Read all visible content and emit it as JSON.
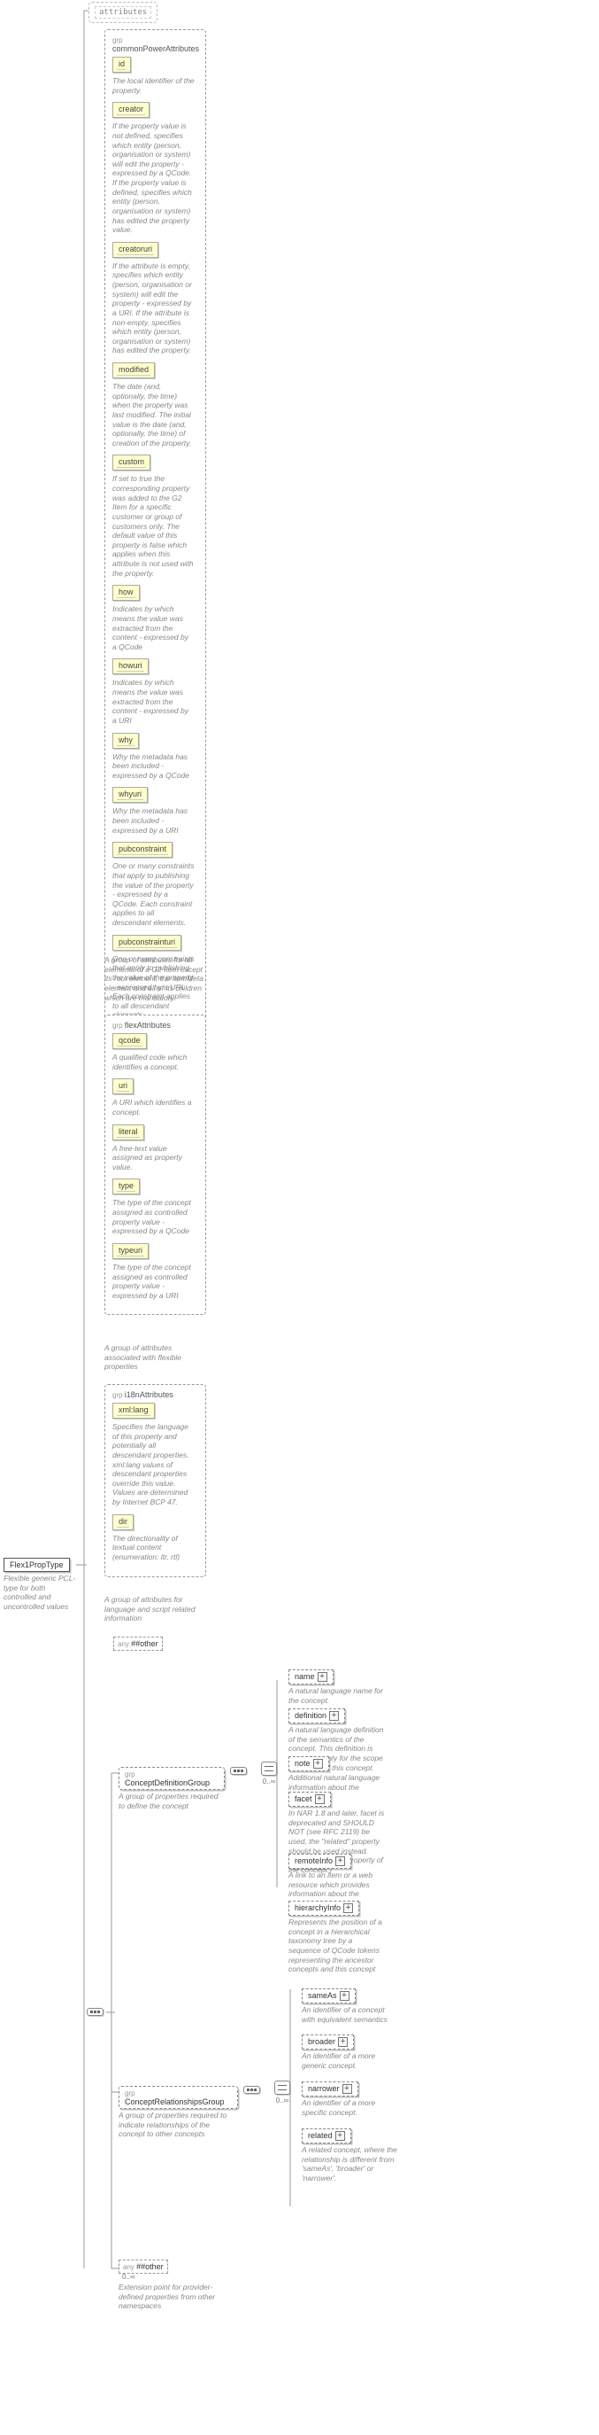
{
  "root": {
    "name": "Flex1PropType",
    "doc": "Flexible generic PCL-type for both controlled and uncontrolled values"
  },
  "groups": {
    "common": {
      "title": "commonPowerAttributes",
      "attrs": [
        {
          "name": "id",
          "doc": "The local identifier of the property."
        },
        {
          "name": "creator",
          "doc": "If the property value is not defined, specifies which entity (person, organisation or system) will edit the property - expressed by a QCode. If the property value is defined, specifies which entity (person, organisation or system) has edited the property value."
        },
        {
          "name": "creatoruri",
          "doc": "If the attribute is empty, specifies which entity (person, organisation or system) will edit the property - expressed by a URI. If the attribute is non-empty, specifies which entity (person, organisation or system) has edited the property."
        },
        {
          "name": "modified",
          "doc": "The date (and, optionally, the time) when the property was last modified. The initial value is the date (and, optionally, the time) of creation of the property."
        },
        {
          "name": "custom",
          "doc": "If set to true the corresponding property was added to the G2 Item for a specific customer or group of customers only. The default value of this property is false which applies when this attribute is not used with the property."
        },
        {
          "name": "how",
          "doc": "Indicates by which means the value was extracted from the content - expressed by a QCode"
        },
        {
          "name": "howuri",
          "doc": "Indicates by which means the value was extracted from the content - expressed by a URI"
        },
        {
          "name": "why",
          "doc": "Why the metadata has been included - expressed by a QCode"
        },
        {
          "name": "whyuri",
          "doc": "Why the metadata has been included - expressed by a URI"
        },
        {
          "name": "pubconstraint",
          "doc": "One or many constraints that apply to publishing the value of the property - expressed by a QCode. Each constraint applies to all descendant elements."
        },
        {
          "name": "pubconstrainturi",
          "doc": "One or many constraints that apply to publishing the value of the property - expressed by a URI. Each constraint applies to all descendant elements."
        }
      ],
      "footer": "A group of attributes for all elements of a G2 Item except its root element, the itemMeta element and all of its children which are mandatory."
    },
    "flex": {
      "title": "flexAttributes",
      "attrs": [
        {
          "name": "qcode",
          "doc": "A qualified code which identifies a concept."
        },
        {
          "name": "uri",
          "doc": "A URI which identifies a concept."
        },
        {
          "name": "literal",
          "doc": "A free-text value assigned as property value."
        },
        {
          "name": "type",
          "doc": "The type of the concept assigned as controlled property value - expressed by a QCode"
        },
        {
          "name": "typeuri",
          "doc": "The type of the concept assigned as controlled property value - expressed by a URI"
        }
      ],
      "footer": "A group of attributes associated with flexible properties"
    },
    "i18n": {
      "title": "i18nAttributes",
      "attrs": [
        {
          "name": "xml:lang",
          "doc": "Specifies the language of this property and potentially all descendant properties. xml:lang values of descendant properties override this value. Values are determined by Internet BCP 47."
        },
        {
          "name": "dir",
          "doc": "The directionality of textual content (enumeration: ltr, rtl)"
        }
      ],
      "footer": "A group of attributes for language and script related information"
    }
  },
  "attributesLabel": "attributes",
  "anyOther": "##other",
  "conceptDef": {
    "label": "ConceptDefinitionGroup",
    "doc": "A group of properties required to define the concept",
    "children": [
      {
        "name": "name",
        "doc": "A natural language name for the concept."
      },
      {
        "name": "definition",
        "doc": "A natural language definition of the semantics of the concept. This definition is normative only for the scope of the use of this concept."
      },
      {
        "name": "note",
        "doc": "Additional natural language information about the concept."
      },
      {
        "name": "facet",
        "doc": "In NAR 1.8 and later, facet is deprecated and SHOULD NOT (see RFC 2119) be used, the \"related\" property should be used instead. (was: An intrinsic property of the concept.)"
      },
      {
        "name": "remoteInfo",
        "doc": "A link to an item or a web resource which provides information about the concept."
      },
      {
        "name": "hierarchyInfo",
        "doc": "Represents the position of a concept in a hierarchical taxonomy tree by a sequence of QCode tokens representing the ancestor concepts and this concept"
      }
    ]
  },
  "conceptRel": {
    "label": "ConceptRelationshipsGroup",
    "doc": "A group of properties required to indicate relationships of the concept to other concepts",
    "children": [
      {
        "name": "sameAs",
        "doc": "An identifier of a concept with equivalent semantics"
      },
      {
        "name": "broader",
        "doc": "An identifier of a more generic concept."
      },
      {
        "name": "narrower",
        "doc": "An identifier of a more specific concept."
      },
      {
        "name": "related",
        "doc": "A related concept, where the relationship is different from 'sameAs', 'broader' or 'narrower'."
      }
    ]
  },
  "bottomAny": {
    "label": "##other",
    "doc": "Extension point for provider-defined properties from other namespaces"
  },
  "occ": "0..∞"
}
